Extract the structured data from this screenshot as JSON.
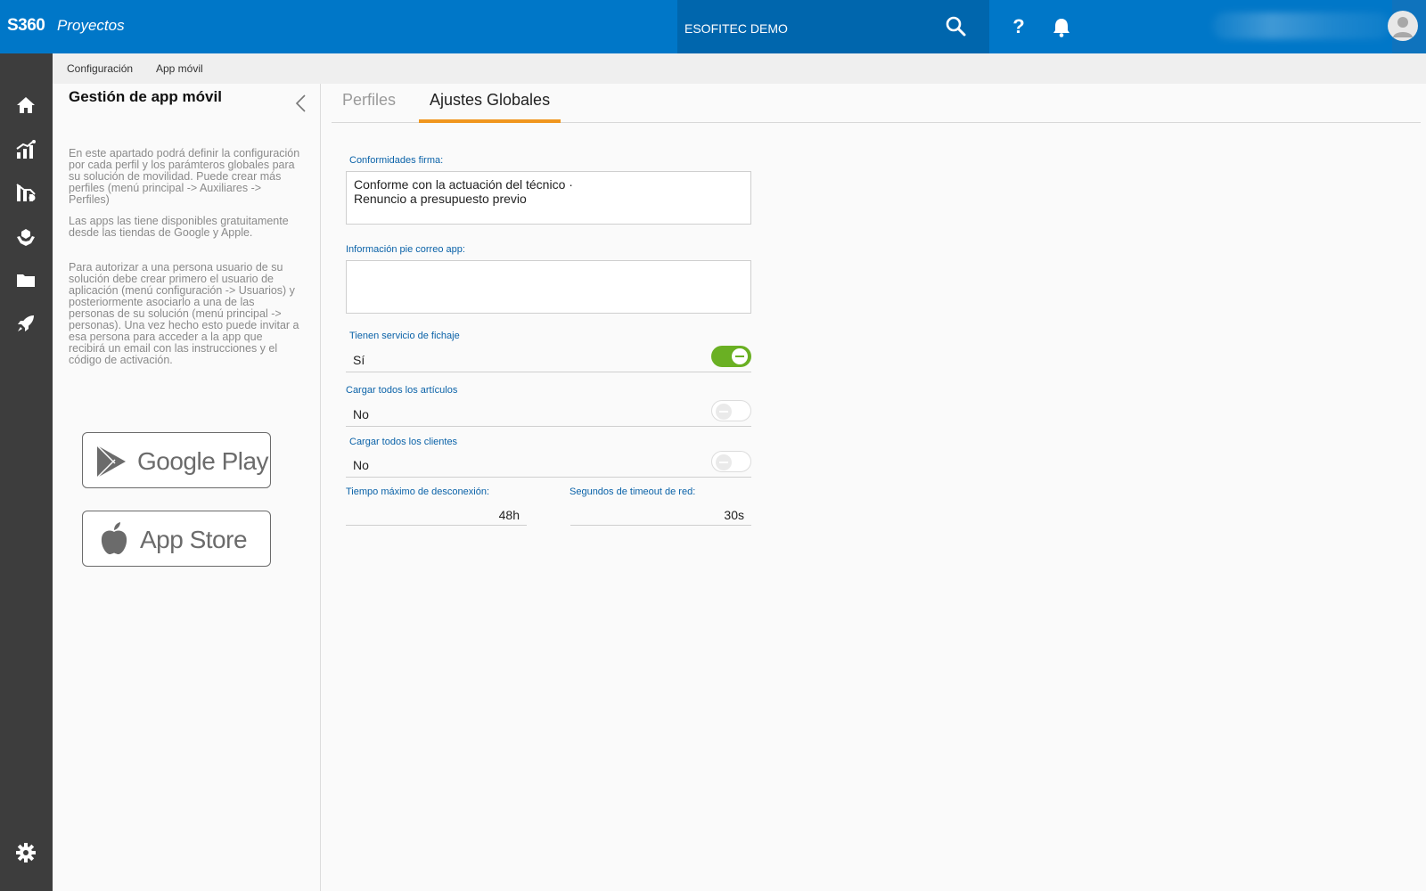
{
  "topbar": {
    "brand": "S360",
    "product": "Proyectos",
    "company": "ESOFITEC DEMO",
    "help_label": "?",
    "brand_color": "#0077c8"
  },
  "leftnav": {
    "icons": [
      "home-icon",
      "chart-icon",
      "analytics-icon",
      "hands-icon",
      "folder-icon",
      "rocket-icon"
    ],
    "bottom_icon": "gear-icon"
  },
  "breadcrumb": {
    "items": [
      "Configuración",
      "App móvil"
    ]
  },
  "info_panel": {
    "title": "Gestión de app móvil",
    "paragraphs": [
      "En este apartado podrá definir la configuración por cada perfil y los parámteros globales para su solución de movilidad. Puede crear más perfiles (menú principal -> Auxiliares -> Perfiles)",
      "Las apps las tiene disponibles gratuitamente desde las tiendas de Google y Apple.",
      "Para autorizar a una persona usuario de su solución debe crear primero el usuario de aplicación (menú configuración -> Usuarios) y posteriormente asociarlo a una de las personas de su solución (menú principal -> personas). Una vez hecho esto puede invitar a esa persona para acceder a la app que recibirá un email con las instrucciones y el código de activación."
    ],
    "stores": {
      "google": "Google Play",
      "apple": "App Store"
    }
  },
  "tabs": [
    {
      "label": "Perfiles",
      "active": false
    },
    {
      "label": "Ajustes Globales",
      "active": true
    }
  ],
  "form": {
    "conformidades": {
      "label": "Conformidades firma:",
      "value": "Conforme con la actuación del técnico ·\nRenuncio a presupuesto previo"
    },
    "pie_correo": {
      "label": "Información pie correo app:",
      "value": ""
    },
    "fichaje": {
      "label": "Tienen servicio de fichaje",
      "value": "Sí",
      "enabled": true
    },
    "articulos": {
      "label": "Cargar todos los artículos",
      "value": "No",
      "enabled": false
    },
    "clientes": {
      "label": "Cargar todos los clientes",
      "value": "No",
      "enabled": false
    },
    "desconexion": {
      "label": "Tiempo máximo de desconexión:",
      "value": "48h"
    },
    "timeout": {
      "label": "Segundos de timeout de red:",
      "value": "30s"
    },
    "accent_color": "#f0961e",
    "toggle_on_color": "#6ab023"
  }
}
